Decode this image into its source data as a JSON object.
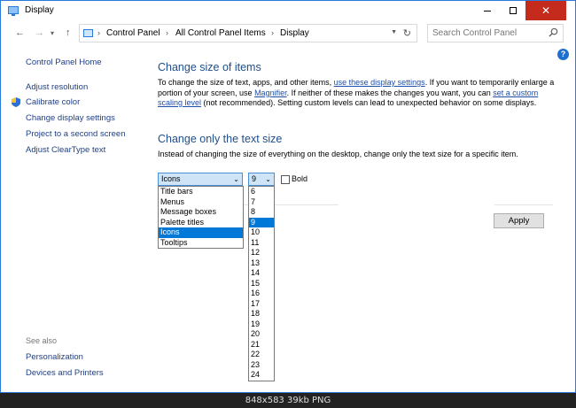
{
  "window": {
    "title": "Display"
  },
  "address": {
    "crumbs": [
      "Control Panel",
      "All Control Panel Items",
      "Display"
    ],
    "search_placeholder": "Search Control Panel"
  },
  "sidebar": {
    "home": "Control Panel Home",
    "links": [
      "Adjust resolution",
      "Calibrate color",
      "Change display settings",
      "Project to a second screen",
      "Adjust ClearType text"
    ],
    "see_also": "See also",
    "see_also_links": [
      "Personalization",
      "Devices and Printers"
    ]
  },
  "main": {
    "heading1": "Change size of items",
    "para1": {
      "t1": "To change the size of text, apps, and other items, ",
      "link1": "use these display settings",
      "t2": ".  If you want to temporarily enlarge a portion of your screen, use ",
      "link2": "Magnifier",
      "t3": ".  If neither of these makes the changes you want, you can ",
      "link3": "set a custom scaling level",
      "t4": " (not recommended).  Setting custom levels can lead to unexpected behavior on some displays."
    },
    "heading2": "Change only the text size",
    "para2": "Instead of changing the size of everything on the desktop, change only the text size for a specific item.",
    "item_select_value": "Icons",
    "size_select_value": "9",
    "bold_label": "Bold",
    "apply_label": "Apply",
    "item_options": [
      "Title bars",
      "Menus",
      "Message boxes",
      "Palette titles",
      "Icons",
      "Tooltips"
    ],
    "size_options": [
      "6",
      "7",
      "8",
      "9",
      "10",
      "11",
      "12",
      "13",
      "14",
      "15",
      "16",
      "17",
      "18",
      "19",
      "20",
      "21",
      "22",
      "23",
      "24"
    ],
    "selected_item_index": 4,
    "selected_size_index": 3
  },
  "caption": "848x583  39kb  PNG"
}
